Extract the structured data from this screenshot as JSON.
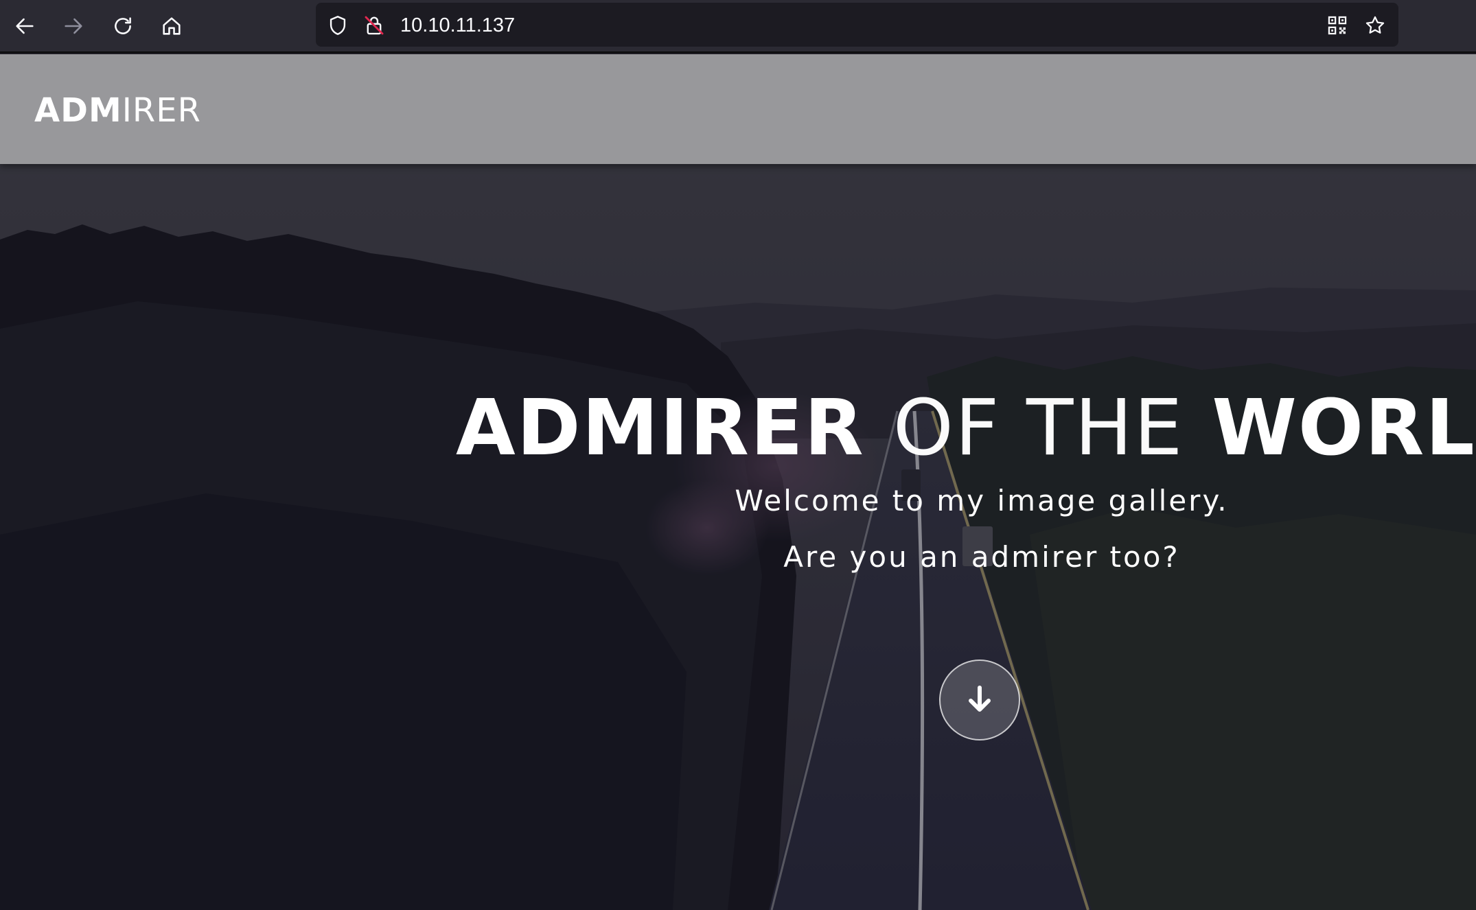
{
  "browser": {
    "url": "10.10.11.137",
    "icons": {
      "back": "arrow-left-icon",
      "forward": "arrow-right-icon",
      "reload": "reload-icon",
      "home": "home-icon",
      "tracking": "shield-icon",
      "insecure": "lock-insecure-icon",
      "qr": "qr-code-icon",
      "bookmark": "star-icon"
    }
  },
  "site": {
    "logo_bold": "ADM",
    "logo_light": "IRER"
  },
  "hero": {
    "title_part1": "ADMIRER",
    "title_part2": "OF THE",
    "title_part3": "WORLD",
    "line1": "Welcome to my image gallery.",
    "line2": "Are you an admirer too?",
    "scroll_icon": "arrow-down-icon"
  },
  "colors": {
    "browser_toolbar": "#2b2a33",
    "url_field": "#1c1b22",
    "header_overlay": "#a6a6a8",
    "text": "#ffffff"
  }
}
